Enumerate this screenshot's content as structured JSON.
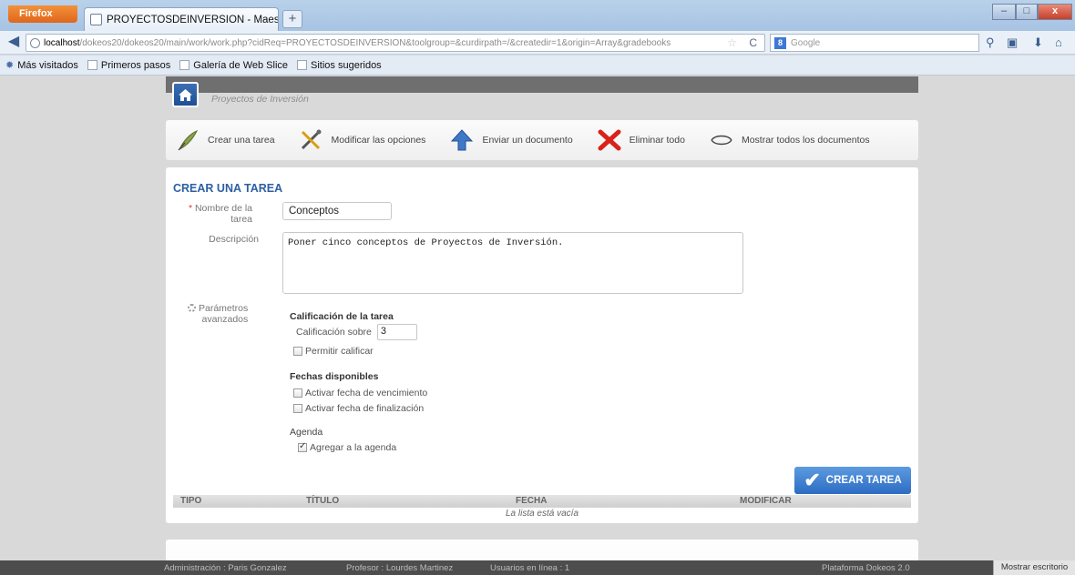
{
  "browser": {
    "menu_button": "Firefox",
    "tab_title": "PROYECTOSDEINVERSION - Maestria en ...",
    "new_tab": "+",
    "url_host": "localhost",
    "url_path": "/dokeos20/dokeos20/main/work/work.php?cidReq=PROYECTOSDEINVERSION&toolgroup=&curdirpath=/&createdir=1&origin=Array&gradebooks",
    "search_placeholder": "Google",
    "search_engine": "8",
    "bookmarks": [
      "Más visitados",
      "Primeros pasos",
      "Galería de Web Slice",
      "Sitios sugeridos"
    ]
  },
  "header": {
    "course_title": "Proyectos de Inversión"
  },
  "toolbar": {
    "create_task": "Crear una tarea",
    "modify_options": "Modificar las opciones",
    "send_document": "Enviar un documento",
    "delete_all": "Eliminar todo",
    "show_all_docs": "Mostrar todos los documentos"
  },
  "form": {
    "title": "CREAR UNA TAREA",
    "required_mark": "*",
    "name_label_1": "Nombre de la",
    "name_label_2": "tarea",
    "name_value": "Conceptos",
    "description_label": "Descripción",
    "description_value": "Poner cinco conceptos de Proyectos de Inversión.",
    "advanced_label_1": "Parámetros",
    "advanced_label_2": "avanzados",
    "grading_title": "Calificación de la tarea",
    "grade_over_label": "Calificación sobre",
    "grade_over_value": "3",
    "allow_grading": "Permitir calificar",
    "allow_grading_checked": false,
    "dates_title": "Fechas disponibles",
    "activate_due_date": "Activar fecha de vencimiento",
    "activate_end_date": "Activar fecha de finalización",
    "agenda_title": "Agenda",
    "add_to_agenda": "Agregar a la agenda",
    "add_to_agenda_checked": true,
    "submit_label": "CREAR TAREA"
  },
  "table": {
    "columns": [
      "TIPO",
      "TÍTULO",
      "FECHA",
      "MODIFICAR"
    ],
    "empty_text": "La lista está vacía"
  },
  "footer": {
    "admin": "Administración : Paris Gonzalez",
    "teacher": "Profesor : Lourdes Martinez",
    "users_online": "Usuarios en línea : 1",
    "platform": "Plataforma Dokeos 2.0",
    "show_desktop": "Mostrar escritorio"
  },
  "colors": {
    "accent": "#2d5fa3",
    "submit_button": "#3a7bd0"
  }
}
